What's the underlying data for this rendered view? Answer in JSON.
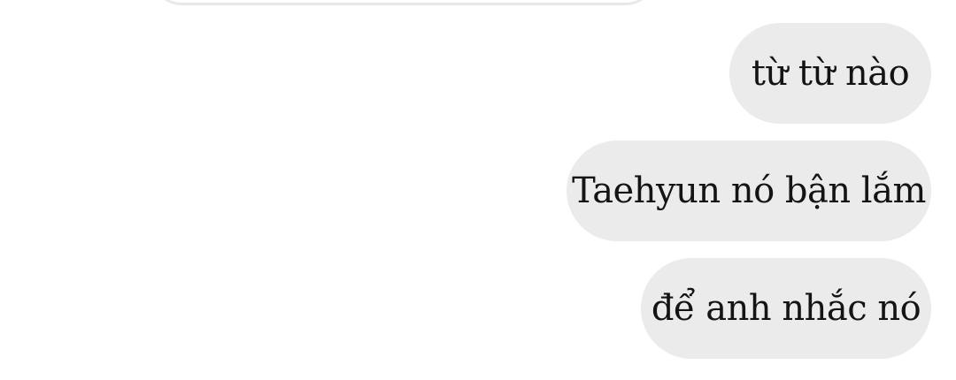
{
  "messages": [
    {
      "text": "từ từ nào"
    },
    {
      "text": "Taehyun nó bận lắm"
    },
    {
      "text": "để anh nhắc nó"
    }
  ]
}
